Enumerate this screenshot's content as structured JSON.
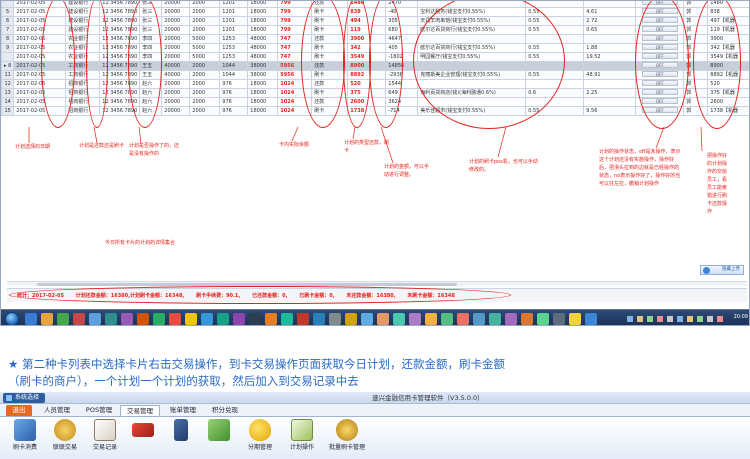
{
  "grid": {
    "rows": [
      {
        "idx": "",
        "date": "2017-02-05",
        "bank": "建设银行",
        "card": "12 3456 7890",
        "name": "张三",
        "limit": "20000",
        "c2": "2000",
        "c3": "1201",
        "c4": "18000",
        "amount": "799",
        "type": "还款",
        "mark": "1480",
        "v1": "2470",
        "desc": "",
        "rate": "",
        "fee": "",
        "op": "OFF",
        "who": "郭",
        "last": "1480"
      },
      {
        "idx": "5",
        "date": "2017-02-05",
        "bank": "建设银行",
        "card": "12 3456 7890",
        "name": "张三",
        "limit": "20000",
        "c2": "2000",
        "c3": "1201",
        "c4": "18000",
        "amount": "799",
        "type": "刷卡",
        "mark": "838",
        "v1": "-40",
        "desc": "宝利达税务(钱宝支付0.55%)",
        "rate": "0.55",
        "fee": "4.61",
        "op": "OFF",
        "who": "郭",
        "last": "838"
      },
      {
        "idx": "6",
        "date": "2017-02-05",
        "bank": "建设银行",
        "card": "12 3456 7890",
        "name": "张三",
        "limit": "20000",
        "c2": "2000",
        "c3": "1201",
        "c4": "18000",
        "amount": "799",
        "type": "刷卡",
        "mark": "494",
        "v1": "305",
        "desc": "天润羊肉串馆(钱宝支付0.55%)",
        "rate": "0.55",
        "fee": "2.72",
        "op": "OFF",
        "who": "郭",
        "last": "497【机器"
      },
      {
        "idx": "7",
        "date": "2017-02-05",
        "bank": "建设银行",
        "card": "12 3456 7890",
        "name": "张三",
        "limit": "20000",
        "c2": "2000",
        "c3": "1201",
        "c4": "18000",
        "amount": "799",
        "type": "刷卡",
        "mark": "119",
        "v1": "680",
        "desc": "欧尔达百货商行(钱宝支付0.55%)",
        "rate": "0.55",
        "fee": "0.65",
        "op": "OFF",
        "who": "郭",
        "last": "119【机器"
      },
      {
        "idx": "8",
        "date": "2017-02-05",
        "bank": "农业银行",
        "card": "12 3456 7890",
        "name": "李四",
        "limit": "20000",
        "c2": "5000",
        "c3": "1253",
        "c4": "48000",
        "amount": "747",
        "type": "还款",
        "mark": "3900",
        "v1": "4647",
        "desc": "",
        "rate": "",
        "fee": "",
        "op": "OFF",
        "who": "郭",
        "last": "3900"
      },
      {
        "idx": "9",
        "date": "2017-02-05",
        "bank": "农业银行",
        "card": "12 3456 7890",
        "name": "李四",
        "limit": "20000",
        "c2": "5000",
        "c3": "1253",
        "c4": "48000",
        "amount": "747",
        "type": "刷卡",
        "mark": "342",
        "v1": "405",
        "desc": "欧尔达百货商行(钱宝支付0.55%)",
        "rate": "0.55",
        "fee": "1.88",
        "op": "OFF",
        "who": "郭",
        "last": "342【机器"
      },
      {
        "idx": "",
        "date": "2017-02-05",
        "bank": "农业银行",
        "card": "12 3456 7890",
        "name": "李四",
        "limit": "20000",
        "c2": "5000",
        "c3": "1253",
        "c4": "48000",
        "amount": "747",
        "type": "刷卡",
        "mark": "3549",
        "v1": "-1802",
        "desc": "明园餐厅(钱宝支付0.55%)",
        "rate": "0.55",
        "fee": "19.52",
        "op": "OFF",
        "who": "郭",
        "last": "3549【机器"
      },
      {
        "idx": "▸ 8",
        "date": "2017-02-05",
        "bank": "工商银行",
        "card": "12 3456 7890",
        "name": "王五",
        "limit": "40000",
        "c2": "2000",
        "c3": "1044",
        "c4": "38000",
        "amount": "5956",
        "type": "还款",
        "mark": "8900",
        "v1": "14856",
        "desc": "",
        "rate": "",
        "fee": "",
        "op": "OFF",
        "who": "郭",
        "last": "8900",
        "selected": true
      },
      {
        "idx": "11",
        "date": "2017-02-05",
        "bank": "工商银行",
        "card": "12 3456 7890",
        "name": "王五",
        "limit": "40000",
        "c2": "2000",
        "c3": "1044",
        "c4": "38000",
        "amount": "5956",
        "type": "刷卡",
        "mark": "8892",
        "v1": "-2936",
        "desc": "克丽斯美企业管理(钱宝支付0.55%)",
        "rate": "0.55",
        "fee": "48.91",
        "op": "OFF",
        "who": "郭",
        "last": "8892【机器"
      },
      {
        "idx": "12",
        "date": "2017-02-05",
        "bank": "招商银行",
        "card": "12 3456 7890",
        "name": "赵六",
        "limit": "20000",
        "c2": "2000",
        "c3": "976",
        "c4": "18000",
        "amount": "1024",
        "type": "还款",
        "mark": "520",
        "v1": "1544",
        "desc": "",
        "rate": "",
        "fee": "",
        "op": "OFF",
        "who": "郭",
        "last": "520"
      },
      {
        "idx": "13",
        "date": "2017-02-05",
        "bank": "招商银行",
        "card": "12 3456 7890",
        "name": "赵六",
        "limit": "20000",
        "c2": "2000",
        "c3": "976",
        "c4": "18000",
        "amount": "1024",
        "type": "刷卡",
        "mark": "375",
        "v1": "649",
        "desc": "海利百货商店(钱)(海利融通0.6%)",
        "rate": "0.6",
        "fee": "2.25",
        "op": "OFF",
        "who": "郭",
        "last": "375【机器"
      },
      {
        "idx": "14",
        "date": "2017-02-05",
        "bank": "招商银行",
        "card": "12 3456 7890",
        "name": "赵六",
        "limit": "20000",
        "c2": "2000",
        "c3": "976",
        "c4": "18000",
        "amount": "1024",
        "type": "还款",
        "mark": "2600",
        "v1": "3624",
        "desc": "",
        "rate": "",
        "fee": "",
        "op": "OFF",
        "who": "郭",
        "last": "2600"
      },
      {
        "idx": "15",
        "date": "2017-02-05",
        "bank": "招商银行",
        "card": "12 3456 7890",
        "name": "赵六",
        "limit": "20000",
        "c2": "2000",
        "c3": "976",
        "c4": "18000",
        "amount": "1024",
        "type": "刷卡",
        "mark": "1738",
        "v1": "-714",
        "desc": "美乐佳超市(钱宝支付0.55%)",
        "rate": "0.55",
        "fee": "9.56",
        "op": "OFF",
        "who": "郭",
        "last": "1738【机器"
      }
    ]
  },
  "annotations": {
    "date": "计划选择的日期",
    "card": "计划是还款还是刷卡",
    "done": "计划是否操作了的，还\n是没有操作的",
    "balance": "卡内实际余额",
    "type": "计划的类型还款，刷\n卡",
    "amount": "计划的金额，可以手\n动进行调整。",
    "pos": "计划的刷卡pos机，也可以手动\n修改的。",
    "status": "计划的操作状态，off是未操作，表示\n这个计划还没有实施操作，操作好\n后，把滑头拉到的边就是已经操作的\n状态，no表示操作好了，操作好的也\n可以往左拉，撤销计划操作",
    "staff": "把操作好\n的计划操\n作的交给\n员工，看\n员工能索\n错进行刷\n卡还款操\n作",
    "plan": "今日所有卡片的计划的详情集合"
  },
  "summary": {
    "items": [
      "统计：2017-02-05",
      "计划还款金额：16380,计划刷卡金额：16348,",
      "刷卡手续费：90.1,",
      "已还款金额：0,",
      "已刷卡金额：0,",
      "未还款金额：16380,",
      "未刷卡金额：16348"
    ]
  },
  "float_button": "隐藏上传",
  "clock": "20:09",
  "caption": {
    "star": "★",
    "line1": " 第二种卡列表中选择卡片右击交易操作，到卡交易操作页面获取今日计划，还款金额，刷卡金额",
    "line2": "（刷卡的商户），一个计划一个计划的获取，然后加入到交易记录中去"
  },
  "app": {
    "system_menu": "系统选择",
    "title": "速兴金融信用卡管理软件（V3.5.0.0）",
    "tabs": [
      "退出",
      "人员管理",
      "POS管理",
      "交易管理",
      "账单管理",
      "积分兑现"
    ],
    "active_tab": "交易管理",
    "buttons": [
      {
        "label": "刷卡消费",
        "icon": "card-swipe-icon"
      },
      {
        "label": "联联交易",
        "icon": "coins-icon"
      },
      {
        "label": "交易记录",
        "icon": "notebook-icon"
      },
      {
        "label": "",
        "icon": "red-card-icon"
      },
      {
        "label": "",
        "icon": "pos-terminal-icon"
      },
      {
        "label": "",
        "icon": "green-box-icon"
      },
      {
        "label": "分期管理",
        "icon": "mango-icon"
      },
      {
        "label": "计划操作",
        "icon": "plan-icon"
      },
      {
        "label": "批量刷卡管理",
        "icon": "gold-coin-icon"
      }
    ]
  },
  "colors": {
    "annotation": "#e5231b",
    "caption": "#2a6bc4",
    "quit_tab": "#e66a1f"
  }
}
